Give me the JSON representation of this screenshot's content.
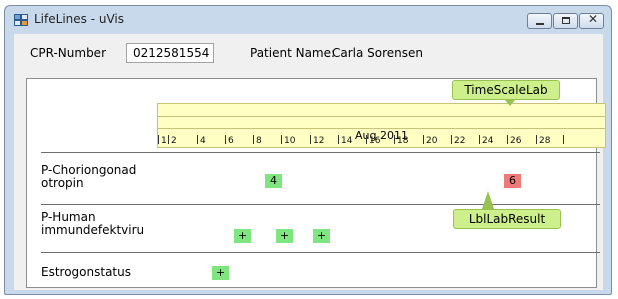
{
  "window": {
    "title": "LifeLines - uVis",
    "controls": [
      "minimize-icon",
      "maximize-icon",
      "close-icon"
    ]
  },
  "header": {
    "cpr_label": "CPR-Number",
    "cpr_value": "0212581554",
    "patient_label": "Patient Name:",
    "patient_value": "Carla Sorensen"
  },
  "timeline": {
    "month": "Aug 2011",
    "ticks": [
      "1",
      "2",
      "4",
      "6",
      "8",
      "10",
      "12",
      "14",
      "16",
      "18",
      "20",
      "22",
      "24",
      "26",
      "28"
    ]
  },
  "rows": [
    {
      "label": "P-Choriongonad otropin",
      "markers": [
        {
          "day": 8,
          "text": "4",
          "status": "normal"
        },
        {
          "day": 24,
          "text": "6",
          "status": "abnormal"
        }
      ]
    },
    {
      "label": "P-Human immundefektviru",
      "markers": [
        {
          "day": 6,
          "text": "+",
          "status": "normal"
        },
        {
          "day": 9,
          "text": "+",
          "status": "normal"
        },
        {
          "day": 11,
          "text": "+",
          "status": "normal"
        }
      ]
    },
    {
      "label": "Estrogonstatus",
      "markers": [
        {
          "day": 5,
          "text": "+",
          "status": "normal"
        }
      ]
    }
  ],
  "callouts": {
    "timescale": "TimeScaleLab",
    "result": "LblLabResult"
  },
  "colors": {
    "normal": "#7fe57f",
    "abnormal": "#f07a7a",
    "timescale_bg": "#ffffc4",
    "callout_bg": "#cdf08c"
  }
}
